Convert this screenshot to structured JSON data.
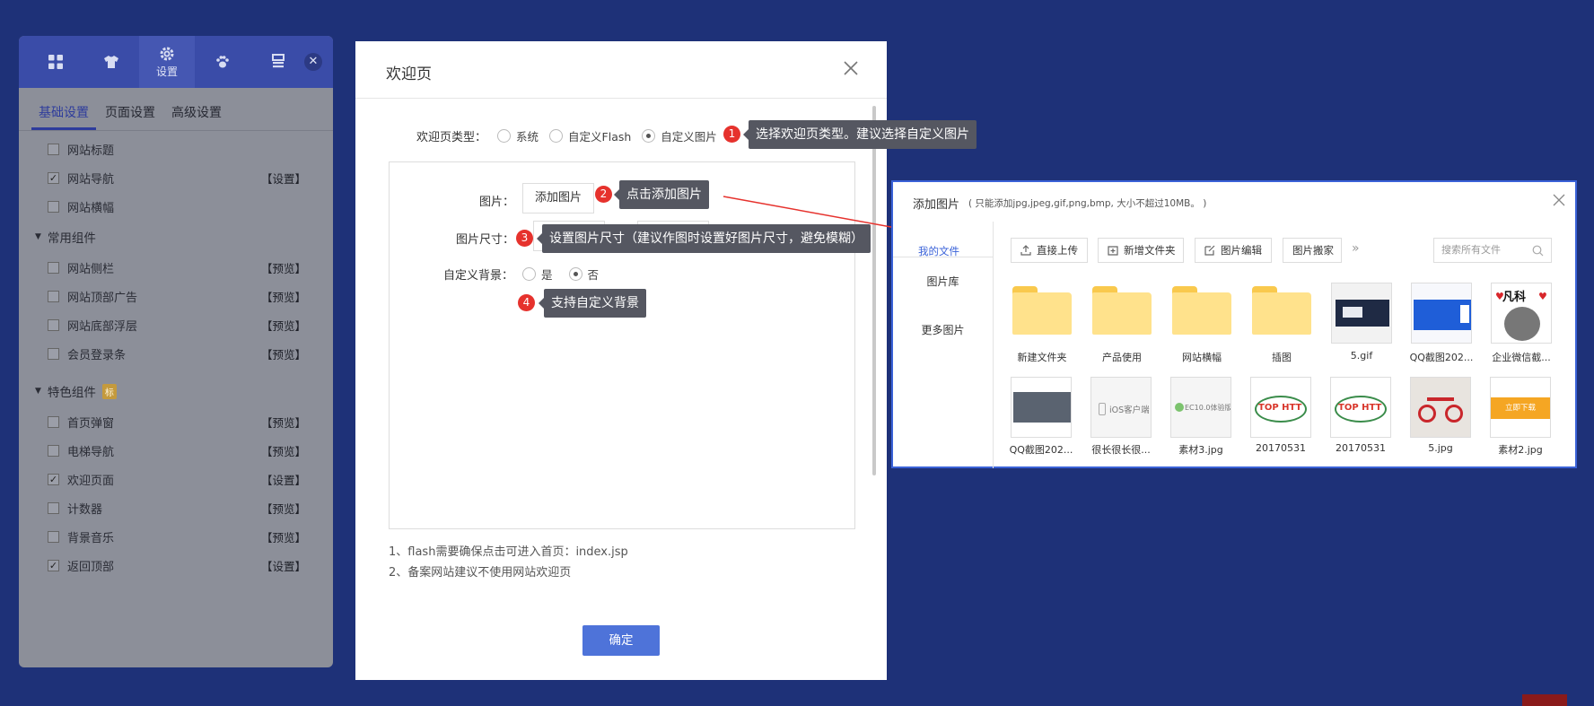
{
  "left_panel": {
    "tabs": [
      {
        "icon": "grid-icon",
        "label": ""
      },
      {
        "icon": "shirt-icon",
        "label": ""
      },
      {
        "icon": "gear-icon",
        "label": "设置"
      },
      {
        "icon": "paw-icon",
        "label": ""
      },
      {
        "icon": "layout-icon",
        "label": ""
      }
    ],
    "close_symbol": "✕",
    "subtabs": [
      "基础设置",
      "页面设置",
      "高级设置"
    ],
    "basic_items": [
      {
        "label": "网站标题",
        "checked": false,
        "action": ""
      },
      {
        "label": "网站导航",
        "checked": true,
        "action": "【设置】"
      },
      {
        "label": "网站横幅",
        "checked": false,
        "action": ""
      }
    ],
    "common_group": "常用组件",
    "common_items": [
      {
        "label": "网站侧栏",
        "checked": false,
        "action": "【预览】"
      },
      {
        "label": "网站顶部广告",
        "checked": false,
        "action": "【预览】"
      },
      {
        "label": "网站底部浮层",
        "checked": false,
        "action": "【预览】"
      },
      {
        "label": "会员登录条",
        "checked": false,
        "action": "【预览】"
      }
    ],
    "feature_group": "特色组件",
    "feature_badge": "标",
    "feature_items": [
      {
        "label": "首页弹窗",
        "checked": false,
        "action": "【预览】"
      },
      {
        "label": "电梯导航",
        "checked": false,
        "action": "【预览】"
      },
      {
        "label": "欢迎页面",
        "checked": true,
        "action": "【设置】"
      },
      {
        "label": "计数器",
        "checked": false,
        "action": "【预览】"
      },
      {
        "label": "背景音乐",
        "checked": false,
        "action": "【预览】"
      },
      {
        "label": "返回顶部",
        "checked": true,
        "action": "【设置】"
      }
    ]
  },
  "dialog": {
    "title": "欢迎页",
    "type_label": "欢迎页类型：",
    "type_options": [
      {
        "label": "系统",
        "selected": false
      },
      {
        "label": "自定义Flash",
        "selected": false
      },
      {
        "label": "自定义图片",
        "selected": true
      }
    ],
    "image_label": "图片：",
    "add_image_button": "添加图片",
    "size_label": "图片尺寸：",
    "bg_label": "自定义背景：",
    "bg_options": [
      {
        "label": "是",
        "selected": false
      },
      {
        "label": "否",
        "selected": true
      }
    ],
    "notes": [
      "1、flash需要确保点击可进入首页：index.jsp",
      "2、备案网站建议不使用网站欢迎页"
    ],
    "ok_button": "确定"
  },
  "callouts": [
    {
      "num": "1",
      "text": "选择欢迎页类型。建议选择自定义图片"
    },
    {
      "num": "2",
      "text": "点击添加图片"
    },
    {
      "num": "3",
      "text": "设置图片尺寸（建议作图时设置好图片尺寸，避免模糊）"
    },
    {
      "num": "4",
      "text": "支持自定义背景"
    }
  ],
  "image_window": {
    "title": "添加图片",
    "subtitle": "( 只能添加jpg,jpeg,gif,png,bmp, 大小不超过10MB。 )",
    "sidebar": {
      "my_files": "我的文件",
      "items": [
        "图片库",
        "更多图片"
      ]
    },
    "toolbar": [
      "直接上传",
      "新增文件夹",
      "图片编辑",
      "图片搬家"
    ],
    "more_symbol": "»",
    "search_placeholder": "搜索所有文件",
    "folders": [
      "新建文件夹",
      "产品使用",
      "网站横幅",
      "插图"
    ],
    "files_row1": [
      "5.gif",
      "QQ截图202...",
      "企业微信截..."
    ],
    "files_row2": [
      "QQ截图202...",
      "很长很长很...",
      "素材3.jpg",
      "20170531",
      "20170531",
      "5.jpg",
      "素材2.jpg"
    ],
    "thumb_texts": {
      "fanke": "凡科",
      "ios": "iOS客户端",
      "ec": "EC10.0体验版",
      "top": "TOP HTT",
      "download": "立即下载"
    }
  },
  "colors": {
    "background": "#1e3178",
    "panel_header": "#3a4ca8",
    "accent_blue": "#4e73d9",
    "callout_red": "#e6322d",
    "tooltip_bg": "#555761",
    "folder_yellow": "#ffe28c"
  }
}
